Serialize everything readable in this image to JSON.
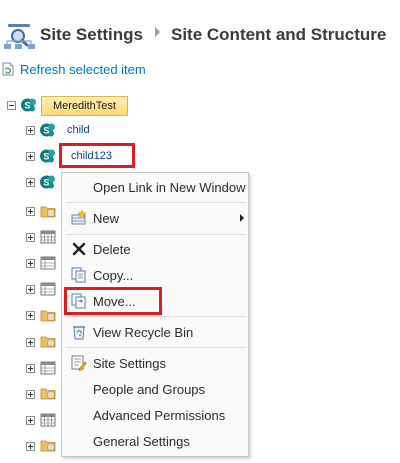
{
  "header": {
    "title": "Site Settings",
    "subtitle": "Site Content and Structure",
    "icon": "sitemap-icon"
  },
  "toolbar": {
    "refresh_label": "Refresh selected item",
    "refresh_icon": "refresh-page-icon"
  },
  "tree": {
    "root": {
      "label": "MeredithTest",
      "icon": "sharepoint-site-icon",
      "expanded": true
    },
    "children": [
      {
        "label": "child",
        "icon": "sharepoint-site-icon"
      },
      {
        "label": "child123",
        "icon": "sharepoint-site-icon",
        "highlighted": true
      },
      {
        "label": "",
        "icon": "sharepoint-site-icon"
      },
      {
        "label": "",
        "icon": "folder-icon"
      },
      {
        "label": "",
        "icon": "calendar-grid-icon"
      },
      {
        "label": "",
        "icon": "list-icon"
      },
      {
        "label": "",
        "icon": "list-icon"
      },
      {
        "label": "",
        "icon": "folder-icon"
      },
      {
        "label": "",
        "icon": "folder-icon"
      },
      {
        "label": "",
        "icon": "list-icon"
      },
      {
        "label": "",
        "icon": "folder-icon"
      },
      {
        "label": "",
        "icon": "calendar-grid-icon"
      },
      {
        "label": "",
        "icon": "folder-icon"
      },
      {
        "label": "",
        "icon": "folder-icon"
      }
    ]
  },
  "context_menu": {
    "items": [
      {
        "label": "Open Link in New Window",
        "icon": ""
      },
      {
        "label": "New",
        "icon": "new-item-icon",
        "has_submenu": true
      },
      {
        "label": "Delete",
        "icon": "delete-x-icon"
      },
      {
        "label": "Copy...",
        "icon": "copy-icon"
      },
      {
        "label": "Move...",
        "icon": "move-icon",
        "highlighted": true
      },
      {
        "label": "View Recycle Bin",
        "icon": "recycle-bin-icon"
      },
      {
        "label": "Site Settings",
        "icon": "site-settings-icon"
      },
      {
        "label": "People and Groups",
        "icon": ""
      },
      {
        "label": "Advanced Permissions",
        "icon": ""
      },
      {
        "label": "General Settings",
        "icon": ""
      }
    ]
  },
  "colors": {
    "highlight_box": "#e11b22",
    "link": "#0072c6",
    "root_selection": "#ffd775",
    "sharepoint_icon": "#0f7b7b"
  }
}
